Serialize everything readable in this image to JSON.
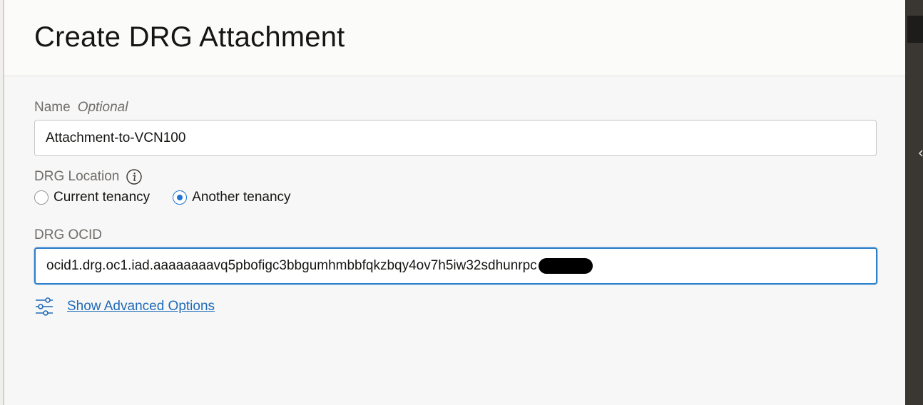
{
  "panel": {
    "title": "Create DRG Attachment"
  },
  "form": {
    "name": {
      "label": "Name",
      "optional_label": "Optional",
      "value": "Attachment-to-VCN100"
    },
    "drg_location": {
      "label": "DRG Location",
      "options": [
        {
          "label": "Current tenancy",
          "selected": false
        },
        {
          "label": "Another tenancy",
          "selected": true
        }
      ]
    },
    "drg_ocid": {
      "label": "DRG OCID",
      "value": "ocid1.drg.oc1.iad.aaaaaaaavq5pbofigc3bbgumhmbbfqkzbqy4ov7h5iw32sdhunrpc"
    },
    "advanced": {
      "link_label": "Show Advanced Options"
    }
  },
  "colors": {
    "accent": "#1f74d1",
    "link": "#1f6bb8",
    "focus_border": "#2e7fc9"
  },
  "icons": {
    "info": "info-icon",
    "advanced": "sliders-icon"
  }
}
